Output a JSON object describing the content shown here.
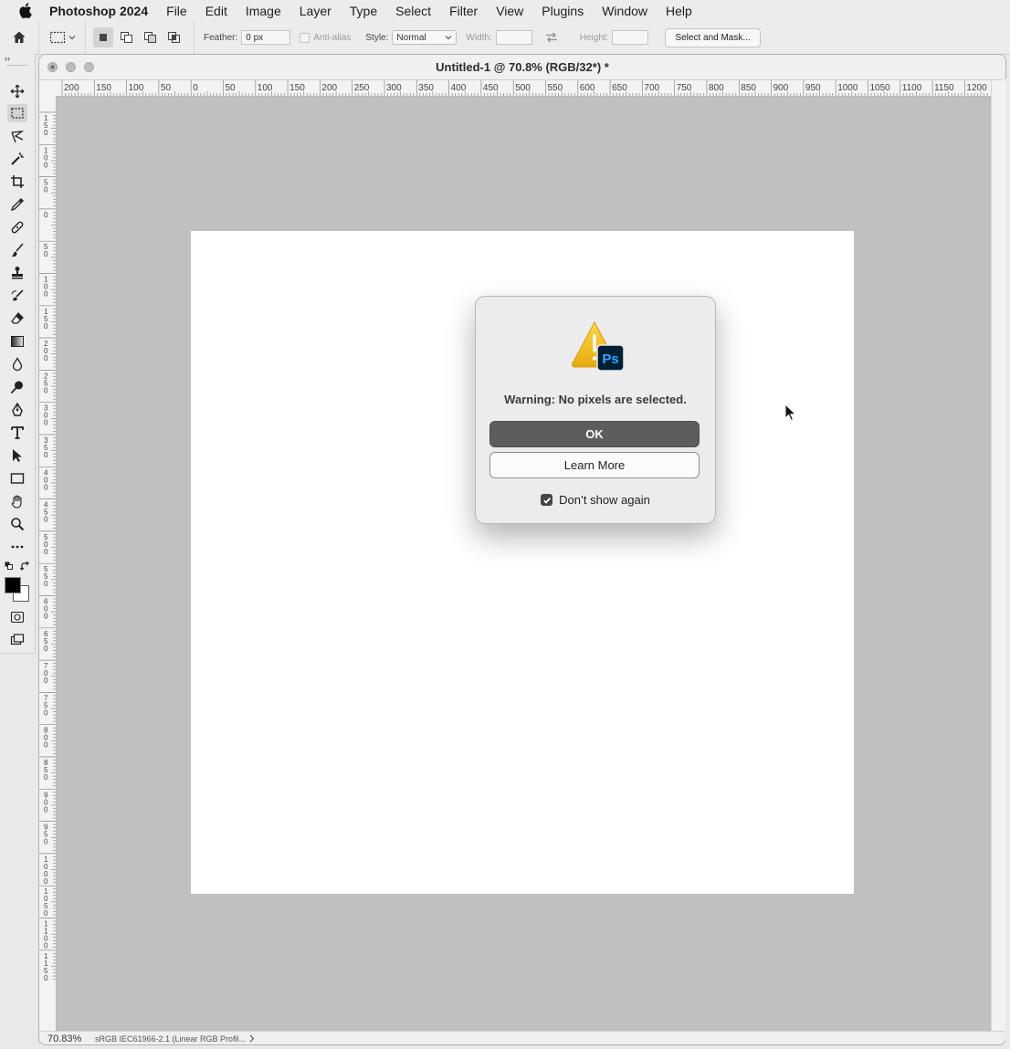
{
  "menubar": {
    "app_name": "Photoshop 2024",
    "items": [
      "File",
      "Edit",
      "Image",
      "Layer",
      "Type",
      "Select",
      "Filter",
      "View",
      "Plugins",
      "Window",
      "Help"
    ]
  },
  "options_bar": {
    "feather_label": "Feather:",
    "feather_value": "0 px",
    "antialias_label": "Anti-alias",
    "style_label": "Style:",
    "style_value": "Normal",
    "width_label": "Width:",
    "height_label": "Height:",
    "select_and_mask_label": "Select and Mask..."
  },
  "tools_panel": {
    "collapse_glyph": "››",
    "active_tool": "rectangular-marquee",
    "foreground_color": "#000000",
    "background_color": "#ffffff"
  },
  "document": {
    "title": "Untitled-1 @ 70.8% (RGB/32*) *",
    "zoom_status": "70.83%",
    "profile_status": "sRGB IEC61966-2.1 (Linear RGB Profil...",
    "ruler_top_labels": [
      "200",
      "150",
      "100",
      "50",
      "0",
      "50",
      "100",
      "150",
      "200",
      "250",
      "300",
      "350",
      "400",
      "450",
      "500",
      "550",
      "600",
      "650",
      "700",
      "750",
      "800",
      "850",
      "900",
      "950",
      "1000",
      "1050",
      "1100",
      "1150",
      "1200"
    ],
    "ruler_left_labels": [
      "150",
      "100",
      "50",
      "0",
      "50",
      "100",
      "150",
      "200",
      "250",
      "300",
      "350",
      "400",
      "450",
      "500",
      "550",
      "600",
      "650",
      "700",
      "750",
      "800",
      "850",
      "900",
      "950",
      "1000",
      "1050",
      "1100",
      "1150"
    ]
  },
  "dialog": {
    "message": "Warning: No pixels are selected.",
    "ok_label": "OK",
    "learn_more_label": "Learn More",
    "dont_show_label": "Don’t show again",
    "dont_show_checked": true,
    "badge_text": "Ps"
  },
  "colors": {
    "canvas_bg": "#c0c0c0",
    "ok_button": "#5d5d5d",
    "ps_badge": "#001e36",
    "ps_text": "#31a8ff",
    "warning_yellow": "#f5c518"
  }
}
